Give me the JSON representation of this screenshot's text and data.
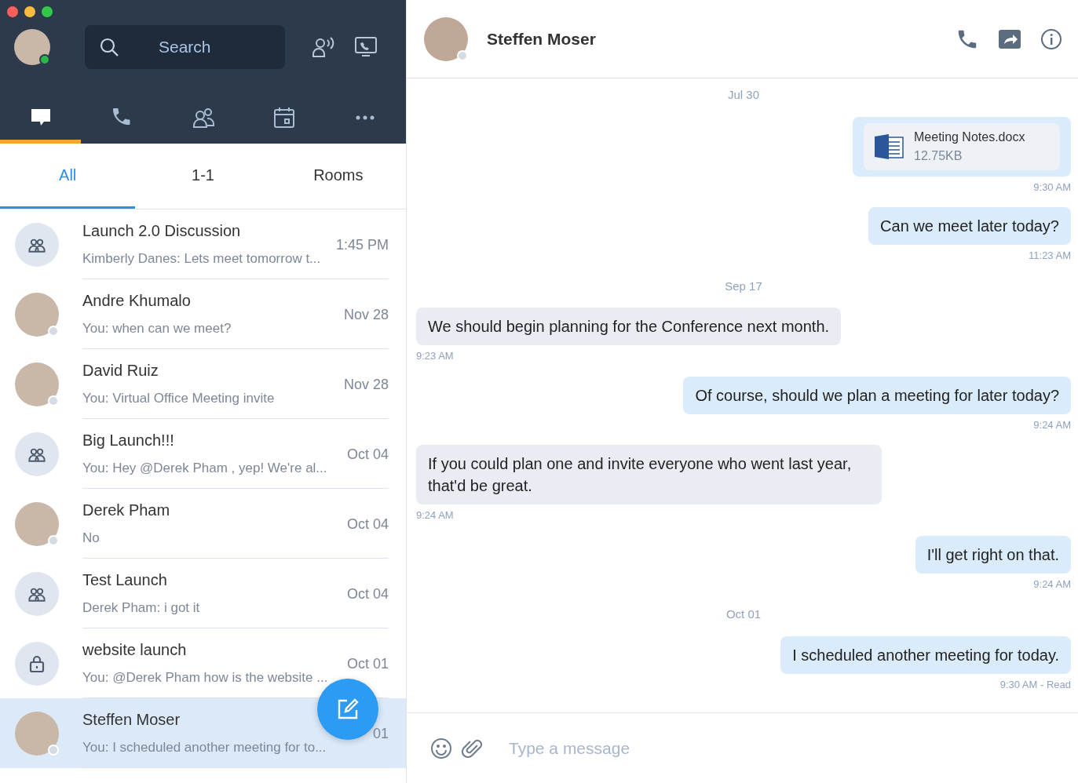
{
  "search": {
    "placeholder": "Search"
  },
  "nav_tabs": [
    {
      "selected": true
    },
    {
      "selected": false
    },
    {
      "selected": false
    },
    {
      "selected": false
    },
    {
      "selected": false
    }
  ],
  "filter_tabs": [
    {
      "label": "All",
      "selected": true
    },
    {
      "label": "1-1",
      "selected": false
    },
    {
      "label": "Rooms",
      "selected": false
    }
  ],
  "conversations": [
    {
      "kind": "group",
      "name": "Launch 2.0 Discussion",
      "preview": "Kimberly Danes: Lets meet tomorrow t...",
      "time": "1:45 PM",
      "selected": false
    },
    {
      "kind": "person",
      "name": "Andre Khumalo",
      "preview": "You: when can we meet?",
      "time": "Nov 28",
      "selected": false
    },
    {
      "kind": "person",
      "name": "David Ruiz",
      "preview": "You: Virtual Office Meeting invite",
      "time": "Nov 28",
      "selected": false
    },
    {
      "kind": "group",
      "name": "Big Launch!!!",
      "preview": "You: Hey @Derek Pham , yep! We're al...",
      "time": "Oct 04",
      "selected": false
    },
    {
      "kind": "person",
      "name": "Derek Pham",
      "preview": "No",
      "time": "Oct 04",
      "selected": false
    },
    {
      "kind": "group",
      "name": "Test Launch",
      "preview": "Derek Pham: i got it",
      "time": "Oct 04",
      "selected": false
    },
    {
      "kind": "locked",
      "name": "website launch",
      "preview": "You: @Derek Pham how is the website ...",
      "time": "Oct 01",
      "selected": false
    },
    {
      "kind": "person",
      "name": "Steffen Moser",
      "preview": "You: I scheduled another meeting for to...",
      "time": "01",
      "selected": true
    }
  ],
  "chat": {
    "title": "Steffen Moser",
    "messages": [
      {
        "kind": "date",
        "text": "Jul 30"
      },
      {
        "kind": "file",
        "outgoing": true,
        "name": "Meeting Notes.docx",
        "size": "12.75KB",
        "time": "9:30 AM"
      },
      {
        "kind": "text",
        "outgoing": true,
        "text": "Can we meet later today?",
        "time": "11:23 AM"
      },
      {
        "kind": "date",
        "text": "Sep 17"
      },
      {
        "kind": "text",
        "outgoing": false,
        "text": "We should begin planning for the Conference next month.",
        "time": "9:23 AM"
      },
      {
        "kind": "text",
        "outgoing": true,
        "text": "Of course, should we plan a meeting for later today?",
        "time": "9:24 AM"
      },
      {
        "kind": "text",
        "outgoing": false,
        "text": "If you could plan one and invite everyone who went last year, that'd be great.",
        "time": "9:24 AM"
      },
      {
        "kind": "text",
        "outgoing": true,
        "text": "I'll get right on that.",
        "time": "9:24 AM"
      },
      {
        "kind": "date",
        "text": "Oct 01"
      },
      {
        "kind": "text",
        "outgoing": true,
        "text": "I scheduled another meeting for today.",
        "time": "9:30 AM - Read"
      }
    ],
    "composer": {
      "placeholder": "Type a message"
    }
  }
}
